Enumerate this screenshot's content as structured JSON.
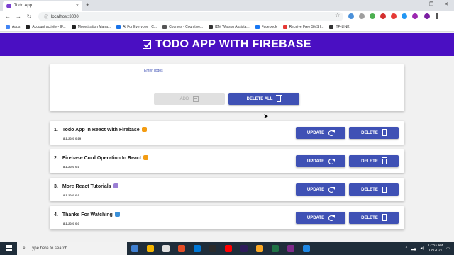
{
  "browser": {
    "tab_title": "Todo App",
    "tab_close": "×",
    "new_tab": "+",
    "url": "localhost:3000",
    "window_controls": [
      "–",
      "❐",
      "✕"
    ],
    "bookmarks": [
      {
        "label": "Apps",
        "color": "#4285f4"
      },
      {
        "label": "Account activity - IF...",
        "color": "#222222"
      },
      {
        "label": "Monetization Mana...",
        "color": "#222222"
      },
      {
        "label": "AI For Everyone | C...",
        "color": "#1a73e8"
      },
      {
        "label": "Courses - Cognitive...",
        "color": "#555555"
      },
      {
        "label": "IBM Watson Assista...",
        "color": "#333333"
      },
      {
        "label": "Facebook",
        "color": "#1877f2"
      },
      {
        "label": "Receive Free SMS I...",
        "color": "#e53935"
      },
      {
        "label": "TP-LINK",
        "color": "#333333"
      }
    ]
  },
  "app": {
    "header_title": "TODO APP WITH FIREBASE",
    "input_label": "Enter Todos",
    "input_value": "",
    "add_label": "ADD",
    "delete_all_label": "DELETE ALL",
    "update_label": "UPDATE",
    "delete_label": "DELETE",
    "accent_color": "#3f51b5",
    "header_color": "#4a0fc2",
    "todos": [
      {
        "number": "1.",
        "text": "Todo App In React With Firebase",
        "emoji_color": "#f39c12",
        "date": "8-1-2021 0:19"
      },
      {
        "number": "2.",
        "text": "Firebase Curd Operation In React",
        "emoji_color": "#f39c12",
        "date": "8-1-2021 0:1"
      },
      {
        "number": "3.",
        "text": "More React Tutorials",
        "emoji_color": "#9b7fd4",
        "date": "8-1-2021 0:1"
      },
      {
        "number": "4.",
        "text": "Thanks For Watching",
        "emoji_color": "#3a8fd8",
        "date": "8-1-2021 0:0"
      }
    ]
  },
  "taskbar": {
    "search_placeholder": "Type here to search",
    "time": "12:33 AM",
    "date": "1/8/2021",
    "apps": [
      "#3f7fd1",
      "#f4b400",
      "#e0e0e0",
      "#e44d26",
      "#0078d7",
      "#2b2b2b",
      "#ff0000",
      "#2d1b5a",
      "#f9a825",
      "#217346",
      "#7e2a8a",
      "#1e88e5"
    ]
  }
}
